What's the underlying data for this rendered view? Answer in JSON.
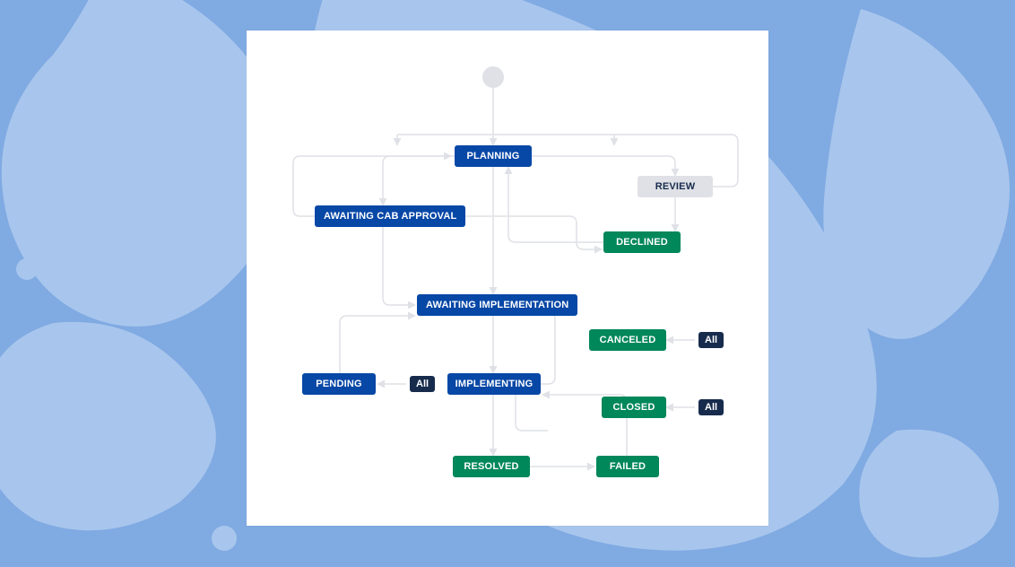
{
  "workflow": {
    "start": true,
    "nodes": {
      "planning": {
        "label": "PLANNING",
        "kind": "blue"
      },
      "review": {
        "label": "REVIEW",
        "kind": "gray"
      },
      "awaiting_cab": {
        "label": "AWAITING CAB APPROVAL",
        "kind": "blue"
      },
      "declined": {
        "label": "DECLINED",
        "kind": "green"
      },
      "awaiting_impl": {
        "label": "AWAITING IMPLEMENTATION",
        "kind": "blue"
      },
      "canceled": {
        "label": "CANCELED",
        "kind": "green"
      },
      "pending": {
        "label": "PENDING",
        "kind": "blue"
      },
      "implementing": {
        "label": "IMPLEMENTING",
        "kind": "blue"
      },
      "closed": {
        "label": "CLOSED",
        "kind": "green"
      },
      "resolved": {
        "label": "RESOLVED",
        "kind": "green"
      },
      "failed": {
        "label": "FAILED",
        "kind": "green"
      }
    },
    "pills": {
      "pending_all": "All",
      "canceled_all": "All",
      "closed_all": "All"
    }
  }
}
